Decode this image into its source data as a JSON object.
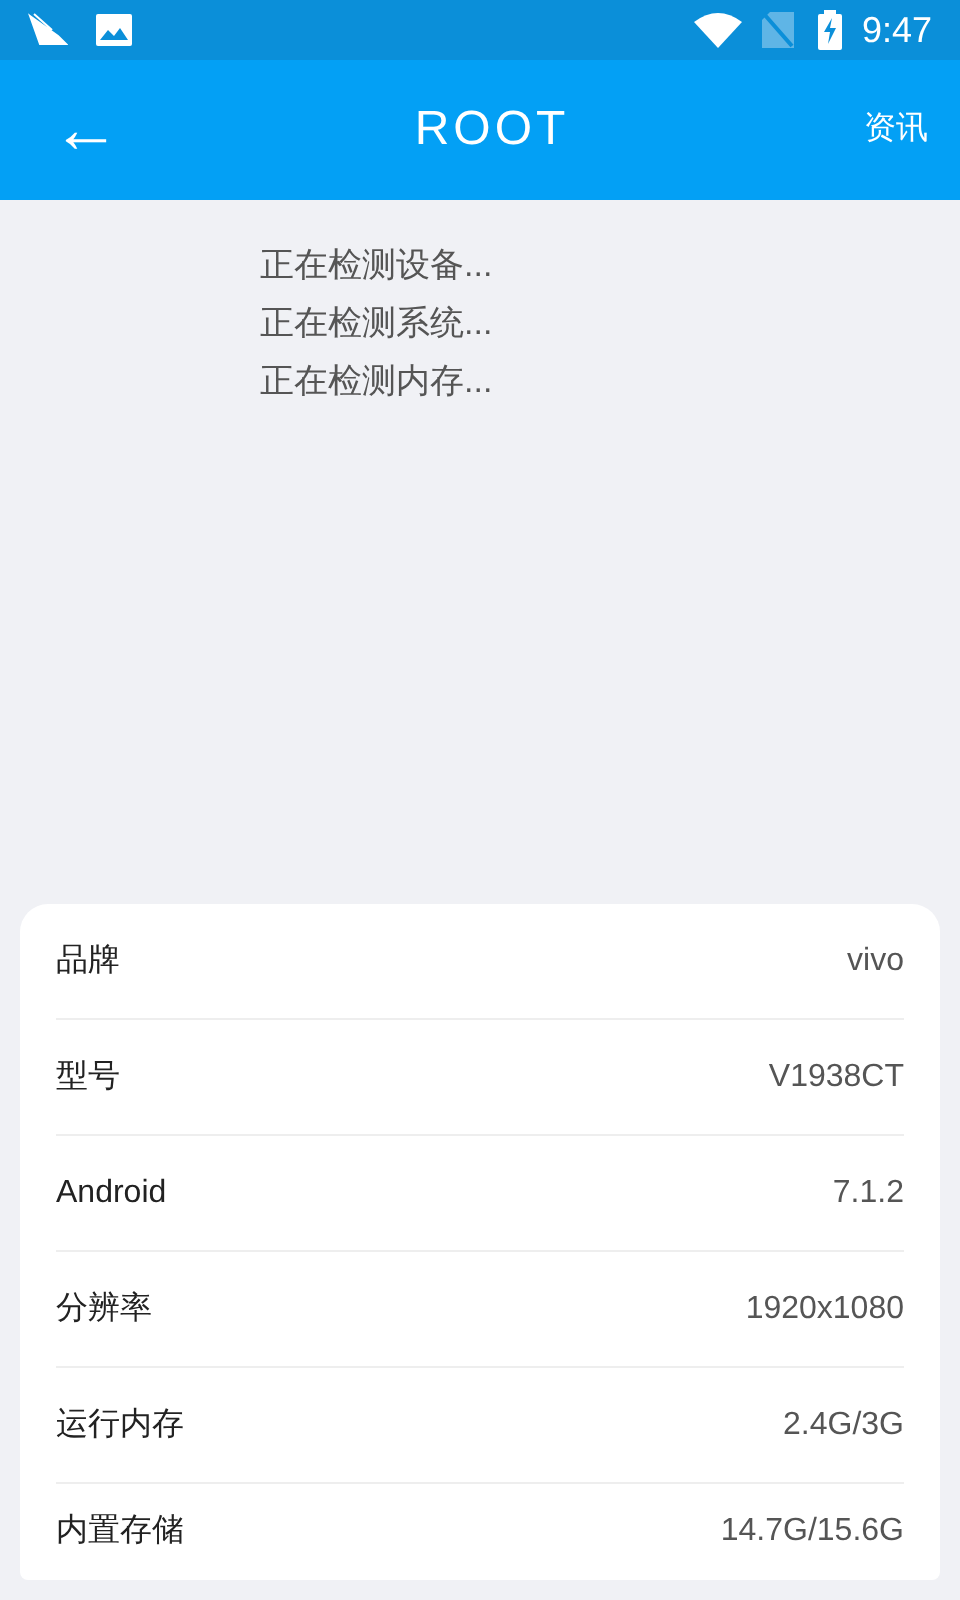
{
  "status_bar": {
    "time": "9:47"
  },
  "app_bar": {
    "back": "←",
    "title": "ROOT",
    "action": "资讯"
  },
  "log": [
    "正在检测设备...",
    "正在检测系统...",
    "正在检测内存..."
  ],
  "info": [
    {
      "label": "品牌",
      "value": "vivo"
    },
    {
      "label": "型号",
      "value": "V1938CT"
    },
    {
      "label": "Android",
      "value": "7.1.2"
    },
    {
      "label": "分辨率",
      "value": "1920x1080"
    },
    {
      "label": "运行内存",
      "value": "2.4G/3G"
    },
    {
      "label": "内置存储",
      "value": "14.7G/15.6G"
    }
  ]
}
